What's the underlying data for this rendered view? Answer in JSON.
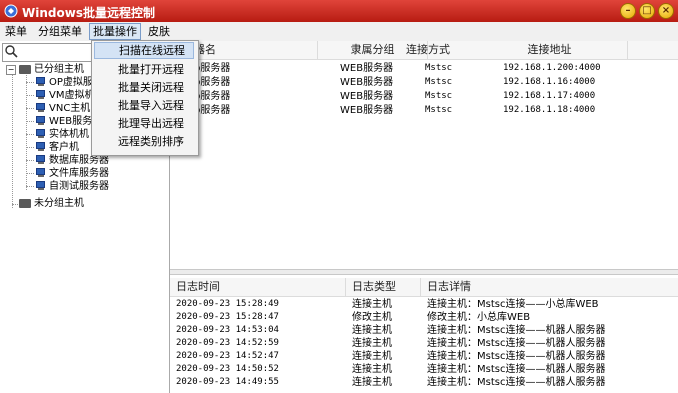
{
  "window": {
    "title": "Windows批量远程控制"
  },
  "menubar": {
    "items": [
      {
        "label": "菜单"
      },
      {
        "label": "分组菜单"
      },
      {
        "label": "批量操作"
      },
      {
        "label": "皮肤"
      }
    ]
  },
  "dropdown": {
    "items": [
      {
        "label": "扫描在线远程"
      },
      {
        "label": "批量打开远程"
      },
      {
        "label": "批量关闭远程"
      },
      {
        "label": "批量导入远程"
      },
      {
        "label": "批理导出远程"
      },
      {
        "label": "远程类别排序"
      }
    ]
  },
  "tree": {
    "root_grouped": "已分组主机",
    "children": [
      "OP虚拟服",
      "VM虚拟机",
      "VNC主机",
      "WEB服务器",
      "实体机机",
      "客户机",
      "数据库服务器",
      "文件库服务器",
      "自测试服务器"
    ],
    "root_ungrouped": "未分组主机"
  },
  "hosts": {
    "headers": [
      "器名",
      "隶属分组",
      "连接方式",
      "连接地址"
    ],
    "rows": [
      {
        "name": "b服务器",
        "group": "WEB服务器",
        "method": "Mstsc",
        "address": "192.168.1.200:4000"
      },
      {
        "name": "b服务器",
        "group": "WEB服务器",
        "method": "Mstsc",
        "address": "192.168.1.16:4000"
      },
      {
        "name": "b服务器",
        "group": "WEB服务器",
        "method": "Mstsc",
        "address": "192.168.1.17:4000"
      },
      {
        "name": "b服务器",
        "group": "WEB服务器",
        "method": "Mstsc",
        "address": "192.168.1.18:4000"
      }
    ]
  },
  "log": {
    "headers": [
      "日志时间",
      "日志类型",
      "日志详情"
    ],
    "rows": [
      {
        "time": "2020-09-23 15:28:49",
        "type": "连接主机",
        "detail": "连接主机：Mstsc连接——小总库WEB"
      },
      {
        "time": "2020-09-23 15:28:47",
        "type": "修改主机",
        "detail": "修改主机：小总库WEB"
      },
      {
        "time": "2020-09-23 14:53:04",
        "type": "连接主机",
        "detail": "连接主机：Mstsc连接——机器人服务器"
      },
      {
        "time": "2020-09-23 14:52:59",
        "type": "连接主机",
        "detail": "连接主机：Mstsc连接——机器人服务器"
      },
      {
        "time": "2020-09-23 14:52:47",
        "type": "连接主机",
        "detail": "连接主机：Mstsc连接——机器人服务器"
      },
      {
        "time": "2020-09-23 14:50:52",
        "type": "连接主机",
        "detail": "连接主机：Mstsc连接——机器人服务器"
      },
      {
        "time": "2020-09-23 14:49:55",
        "type": "连接主机",
        "detail": "连接主机：Mstsc连接——机器人服务器"
      }
    ]
  },
  "icons": {
    "app": "app-logo-icon",
    "search": "search-icon",
    "folder": "folder-icon",
    "host": "computer-icon"
  },
  "colors": {
    "titlebar": "#c9291e",
    "menu_highlight": "#d4e3f5",
    "host_icon": "#2d5fb3"
  }
}
